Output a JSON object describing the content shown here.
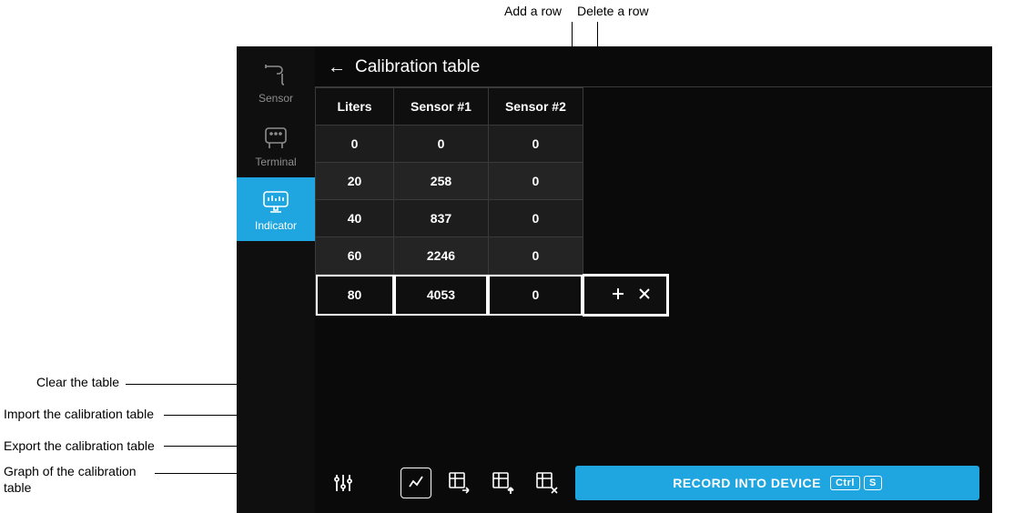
{
  "sidebar": {
    "items": [
      {
        "label": "Sensor"
      },
      {
        "label": "Terminal"
      },
      {
        "label": "Indicator"
      }
    ],
    "active_index": 2
  },
  "header": {
    "title": "Calibration table"
  },
  "table": {
    "columns": [
      "Liters",
      "Sensor #1",
      "Sensor #2"
    ],
    "rows": [
      {
        "liters": "0",
        "s1": "0",
        "s2": "0"
      },
      {
        "liters": "20",
        "s1": "258",
        "s2": "0"
      },
      {
        "liters": "40",
        "s1": "837",
        "s2": "0"
      },
      {
        "liters": "60",
        "s1": "2246",
        "s2": "0"
      },
      {
        "liters": "80",
        "s1": "4053",
        "s2": "0"
      }
    ],
    "selected_row": 4
  },
  "bottom": {
    "record_label": "RECORD INTO DEVICE",
    "shortcut": [
      "Ctrl",
      "S"
    ]
  },
  "annotations": {
    "add_row": "Add a row",
    "delete_row": "Delete a row",
    "clear_table": "Clear the table",
    "import_table": "Import the calibration table",
    "export_table": "Export the calibration table",
    "graph_table": "Graph of the calibration table"
  },
  "colors": {
    "accent": "#1fa6e0",
    "bg_dark": "#0f0f0f"
  }
}
